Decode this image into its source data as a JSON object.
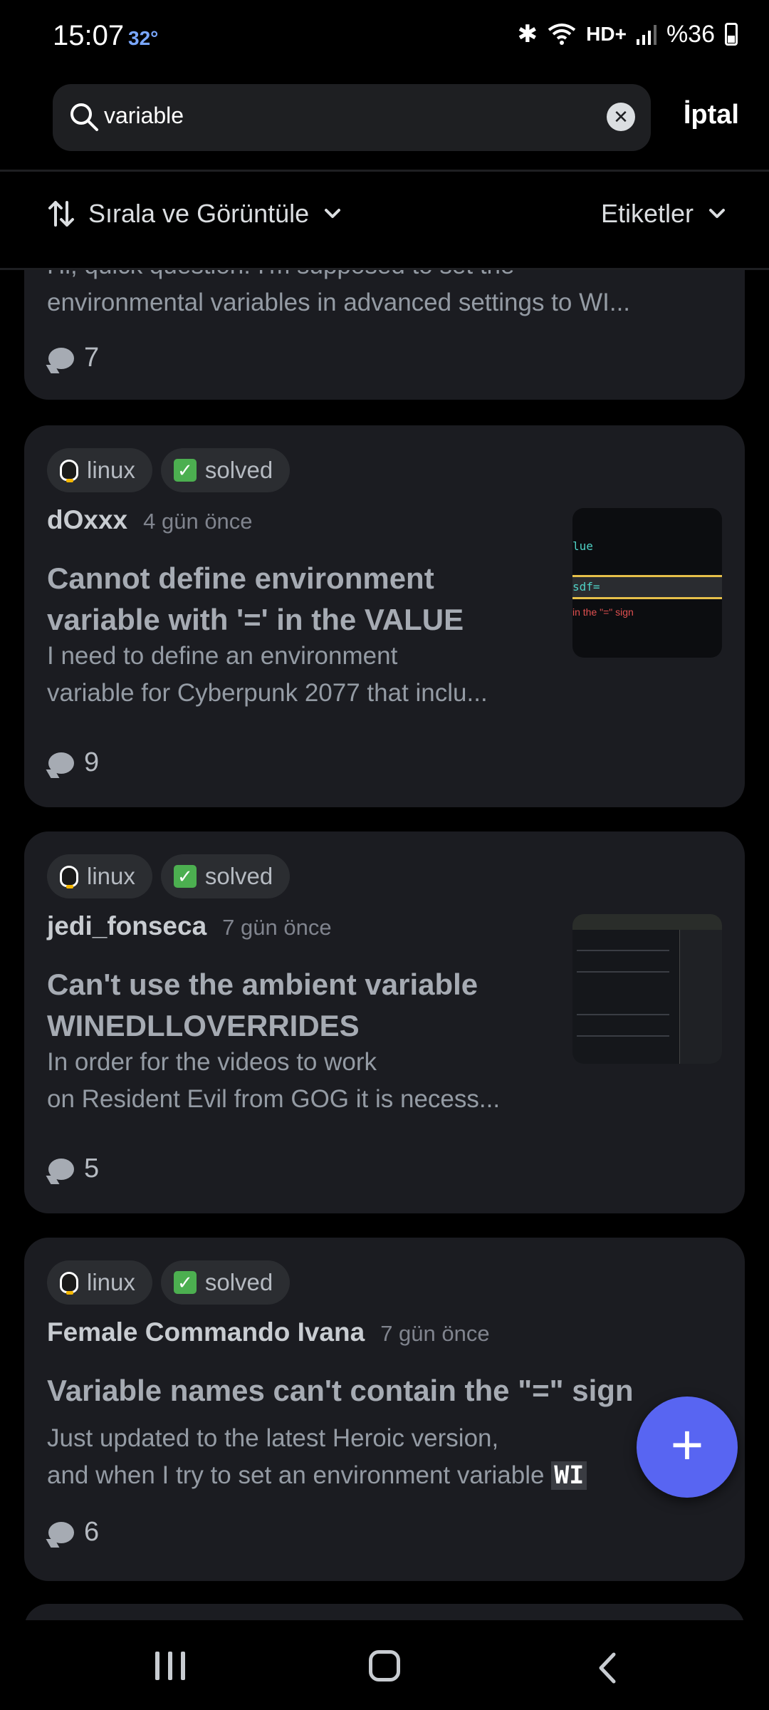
{
  "status_bar": {
    "time": "15:07",
    "temperature": "32°",
    "battery": "%36"
  },
  "search": {
    "query": "variable",
    "cancel_label": "İptal"
  },
  "toolbar": {
    "sort_label": "Sırala ve Görüntüle",
    "tags_label": "Etiketler"
  },
  "posts": [
    {
      "preview_partial_top": "Hi, quick question: I'm supposed to set the",
      "preview": "environmental variables in advanced settings to WI...",
      "comments": "7"
    },
    {
      "tags": [
        "linux",
        "solved"
      ],
      "author": "dOxxx",
      "time": "4 gün önce",
      "title_lines": [
        "Cannot define environment",
        "variable with '=' in the VALUE"
      ],
      "preview_lines": [
        "I need to define an environment",
        "variable for Cyberpunk 2077 that inclu..."
      ],
      "comments": "9",
      "thumb_text": [
        "lue",
        "sdf=",
        "in the \"=\" sign"
      ]
    },
    {
      "tags": [
        "linux",
        "solved"
      ],
      "author": "jedi_fonseca",
      "time": "7 gün önce",
      "title_lines": [
        "Can't use the ambient variable",
        "WINEDLLOVERRIDES"
      ],
      "preview_lines": [
        "In order for the videos to work",
        "on Resident Evil from GOG it is necess..."
      ],
      "comments": "5"
    },
    {
      "tags": [
        "linux",
        "solved"
      ],
      "author": "Female Commando Ivana",
      "time": "7 gün önce",
      "title_lines": [
        "Variable names can't contain the \"=\" sign"
      ],
      "preview_lines": [
        "Just updated to the latest Heroic version,",
        "and when I try to set an environment variable"
      ],
      "preview_code": "WI",
      "comments": "6"
    }
  ],
  "icons": {
    "sort": "sort-arrows-icon",
    "chevron": "chevron-down-icon",
    "search": "search-icon",
    "clear": "clear-icon",
    "fab": "plus-icon",
    "comment": "comment-bubble-icon"
  },
  "colors": {
    "accent": "#5865f2",
    "card_bg": "#1b1c21",
    "solved_check": "#4caf50"
  }
}
